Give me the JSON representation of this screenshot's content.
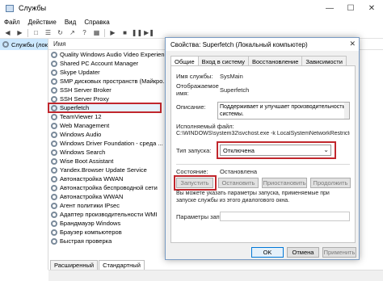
{
  "window": {
    "title": "Службы",
    "menu": [
      "Файл",
      "Действие",
      "Вид",
      "Справка"
    ],
    "toolbar_icons": [
      "back-arrow-icon",
      "forward-arrow-icon",
      "view-icon",
      "list-icon",
      "refresh-icon",
      "export-icon",
      "help-icon",
      "properties-icon",
      "play-icon",
      "stop-icon",
      "pause-icon",
      "restart-icon"
    ]
  },
  "tree": {
    "node_label": "Службы (лока"
  },
  "list": {
    "column_header": "Имя",
    "services": [
      "Quality Windows Audio Video Experien...",
      "Shared PC Account Manager",
      "Skype Updater",
      "SMP дисковых пространств (Майкро...",
      "SSH Server Broker",
      "SSH Server Proxy",
      "Superfetch",
      "TeamViewer 12",
      "Web Management",
      "Windows Audio",
      "Windows Driver Foundation - среда ...",
      "Windows Search",
      "Wise Boot Assistant",
      "Yandex.Browser Update Service",
      "Автонастройка WWAN",
      "Автонастройка беспроводной сети",
      "Автонастройка WWAN",
      "Агент политики IPsec",
      "Адаптер производительности WMI",
      "Брандмауэр Windows",
      "Браузер компьютеров",
      "Быстрая проверка"
    ],
    "highlighted_index": 6
  },
  "bottom_tabs": [
    "Расширенный",
    "Стандартный"
  ],
  "dialog": {
    "title": "Свойства: Superfetch (Локальный компьютер)",
    "tabs": [
      "Общие",
      "Вход в систему",
      "Восстановление",
      "Зависимости"
    ],
    "service_name_label": "Имя службы:",
    "service_name_value": "SysMain",
    "display_name_label": "Отображаемое имя:",
    "display_name_value": "Superfetch",
    "description_label": "Описание:",
    "description_value": "Поддерживает и улучшает производительность системы.",
    "exe_label": "Исполняемый файл:",
    "exe_value": "C:\\WINDOWS\\system32\\svchost.exe -k LocalSystemNetworkRestricted",
    "startup_type_label": "Тип запуска:",
    "startup_type_value": "Отключена",
    "state_label": "Состояние:",
    "state_value": "Остановлена",
    "buttons": [
      "Запустить",
      "Остановить",
      "Приостановить",
      "Продолжить"
    ],
    "note": "Вы можете указать параметры запуска, применяемые при запуске службы из этого диалогового окна.",
    "params_label": "Параметры запуска:"
  },
  "colors": {
    "highlight_red": "#c1272d",
    "selection_blue": "#cce8ff",
    "accent_blue": "#0078d7"
  }
}
